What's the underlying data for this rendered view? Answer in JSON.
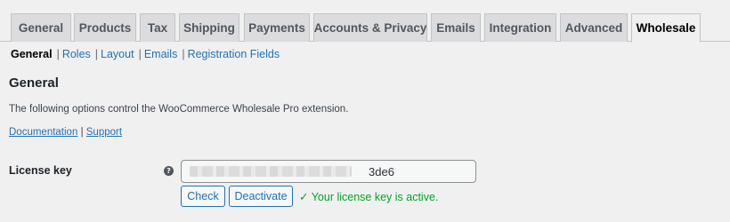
{
  "tabs": [
    {
      "label": "General"
    },
    {
      "label": "Products"
    },
    {
      "label": "Tax"
    },
    {
      "label": "Shipping"
    },
    {
      "label": "Payments"
    },
    {
      "label": "Accounts & Privacy"
    },
    {
      "label": "Emails"
    },
    {
      "label": "Integration"
    },
    {
      "label": "Advanced"
    },
    {
      "label": "Wholesale",
      "active": true
    }
  ],
  "subnav": {
    "current": "General",
    "items": [
      "Roles",
      "Layout",
      "Emails",
      "Registration Fields"
    ],
    "separator": "|"
  },
  "section": {
    "title": "General",
    "description": "The following options control the WooCommerce Wholesale Pro extension.",
    "documentation_link": "Documentation",
    "links_separator": "|",
    "support_link": "Support"
  },
  "license": {
    "label": "License key",
    "help_icon": "question-circle-icon",
    "value_visible_suffix": "3de6",
    "check_label": "Check",
    "deactivate_label": "Deactivate",
    "status_text": "✓ Your license key is active.",
    "status_color": "#00a32a"
  },
  "colors": {
    "background": "#f0f0f1",
    "link": "#2271b1",
    "tab_inactive": "#dcdcde"
  }
}
